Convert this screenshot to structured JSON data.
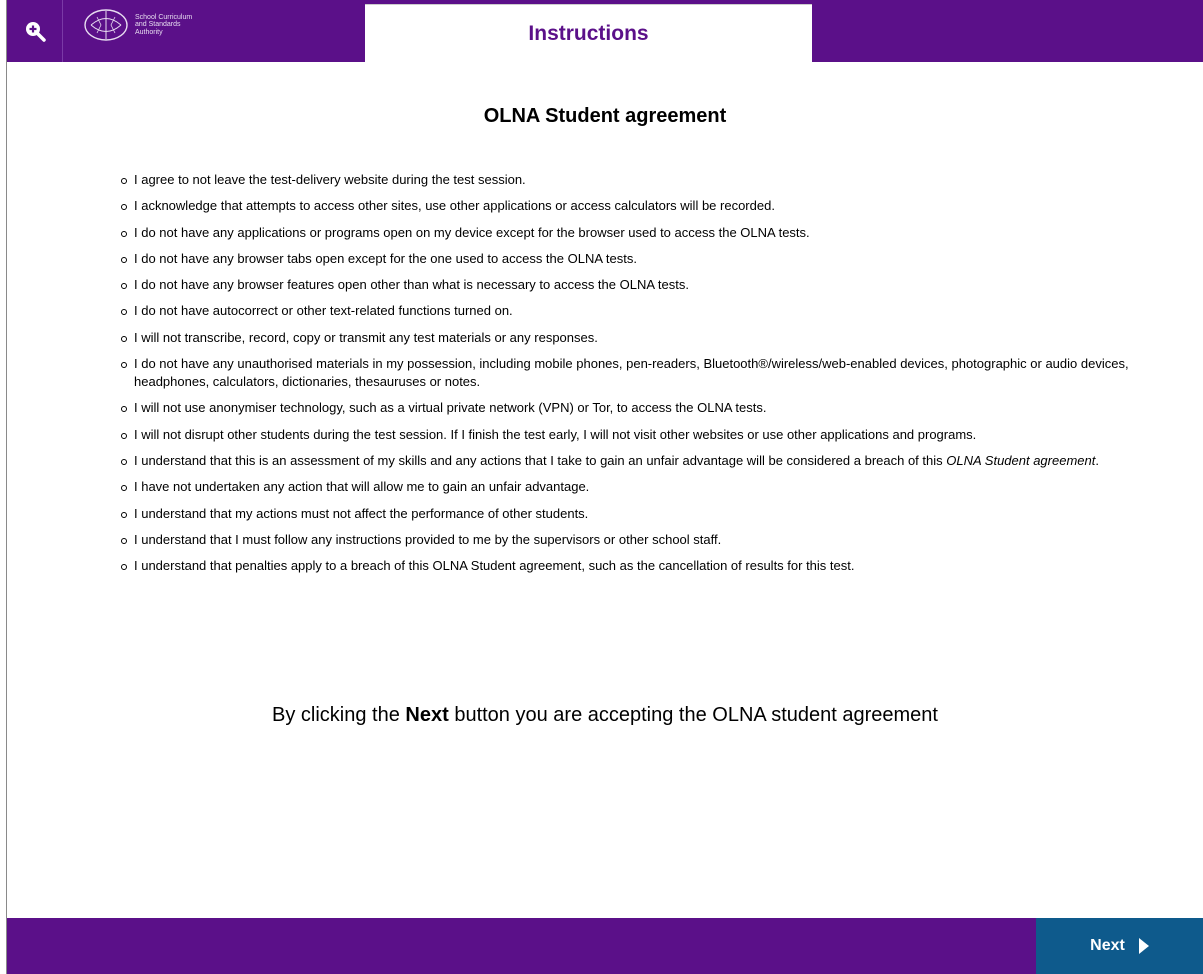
{
  "header": {
    "tab_title": "Instructions",
    "logo_text": [
      "School Curriculum",
      "and Standards",
      "Authority"
    ],
    "zoom_icon": "zoom-in-icon"
  },
  "main": {
    "title": "OLNA Student agreement",
    "items": [
      {
        "text": "I agree to not leave the test-delivery website during the test session."
      },
      {
        "text": "I acknowledge that attempts to access other sites, use other applications or access calculators will be recorded."
      },
      {
        "text": "I do not have any applications or programs open on my device except for the browser used to access the OLNA tests."
      },
      {
        "text": "I do not have any browser tabs open except for the one used to access the OLNA tests."
      },
      {
        "text": "I do not have any browser features open other than what is necessary to access the OLNA tests."
      },
      {
        "text": "I do not have autocorrect or other text-related functions turned on."
      },
      {
        "text": "I will not transcribe, record, copy or transmit any test materials or any responses."
      },
      {
        "text": "I do not have any unauthorised materials in my possession, including mobile phones, pen-readers, Bluetooth®/wireless/web-enabled devices, photographic or audio devices, headphones, calculators, dictionaries, thesauruses or notes."
      },
      {
        "text": "I will not use anonymiser technology, such as a virtual private network (VPN) or Tor, to access the OLNA tests."
      },
      {
        "text": "I will not disrupt other students during the test session. If I finish the test early, I will not visit other websites or use other applications and programs."
      },
      {
        "text": "I understand that this is an assessment of my skills and any actions that I take to gain an unfair advantage will be considered a breach of this ",
        "emphasis": "OLNA Student agreement",
        "suffix": "."
      },
      {
        "text": "I have not undertaken any action that will allow me to gain an unfair advantage."
      },
      {
        "text": "I understand that my actions must not affect the performance of other students."
      },
      {
        "text": "I understand that I must follow any instructions provided to me by the supervisors or other school staff."
      },
      {
        "text": "I understand that penalties apply to a breach of this OLNA Student agreement, such as the cancellation of results for this test."
      }
    ],
    "accept_note": {
      "before": "By clicking the ",
      "bold": "Next",
      "after": " button you are accepting the OLNA student agreement"
    }
  },
  "footer": {
    "next_label": "Next",
    "next_icon": "play-arrow-icon"
  },
  "colors": {
    "brand_purple": "#5b1089",
    "next_blue": "#0e5a8c"
  }
}
